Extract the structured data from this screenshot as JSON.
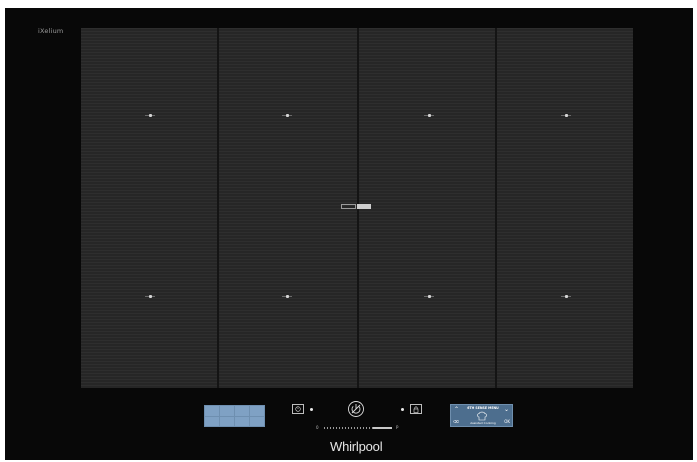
{
  "hob": {
    "series_label": "iXelium",
    "brand": "Whirlpool"
  },
  "cooking_zones": {
    "columns": 4,
    "rows": 2
  },
  "controls": {
    "zone_selector_cells": 8,
    "slider": {
      "min_label": "0",
      "max_label": "P",
      "level_fraction": 0.72
    },
    "display": {
      "title": "6TH SENSE MENU",
      "subtitle": "Assisted Cooking",
      "up_icon": "chevron-up-icon",
      "down_icon": "chevron-down-icon",
      "ok_label": "OK",
      "back_label": "⌫"
    },
    "icons": {
      "timer": "timer-icon",
      "power": "power-icon",
      "lock": "lock-icon"
    }
  },
  "colors": {
    "glass": "#080808",
    "surface": "#2a2a2a",
    "display_accent": "#4d6e8e"
  }
}
